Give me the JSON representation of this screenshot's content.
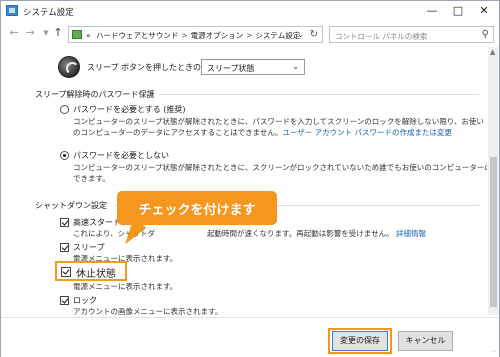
{
  "window": {
    "title": "システム設定"
  },
  "address": {
    "crumbs": [
      "«",
      "ハードウェアとサウンド",
      "電源オプション",
      "システム設定"
    ],
    "separators": [
      ">",
      ">"
    ],
    "search_placeholder": "コントロール パネルの検索"
  },
  "sleep_button": {
    "label": "スリープ ボタンを押したときの動作:",
    "value": "スリープ状態"
  },
  "wake_password": {
    "heading": "スリープ解除時のパスワード保護",
    "require": {
      "label": "パスワードを必要とする (推奨)",
      "desc_line1": "コンピューターのスリープ状態が解除されたときに、パスワードを入力してスクリーンのロックを解除しない限り、お使い",
      "desc_line2": "のコンピューターのデータにアクセスすることはできません。",
      "link_text": "ユーザー アカウント パスワードの作成または変更",
      "selected": false
    },
    "no_require": {
      "label": "パスワードを必要としない",
      "desc_line1": "コンピューターのスリープ状態が解除されたときに、スクリーンがロックされていないため誰でもお使いのコンピューターのデータにアクセス",
      "desc_line2": "できます。",
      "selected": true
    }
  },
  "shutdown": {
    "heading": "シャットダウン設定",
    "fast_startup": {
      "label": "高速スタートアップ",
      "desc": "これにより、シャットダウン後の PC の起動時間が速くなります。再起動は影響を受けません。",
      "desc_prefix": "これにより、シャットダ",
      "desc_suffix": "起動時間が速くなります。再起動は影響を受けません。",
      "link_text": "詳細情報",
      "checked": true
    },
    "sleep": {
      "label": "スリープ",
      "desc": "電源メニューに表示されます。",
      "checked": true
    },
    "hibernate": {
      "label": "休止状態",
      "desc": "電源メニューに表示されます。",
      "checked": true
    },
    "lock": {
      "label": "ロック",
      "desc": "アカウントの画像メニューに表示されます。",
      "checked": true
    }
  },
  "callout": {
    "text": "チェックを付けます"
  },
  "footer": {
    "save_label": "変更の保存",
    "cancel_label": "キャンセル"
  },
  "colors": {
    "highlight": "#f29a1f",
    "callout": "#f5961e",
    "link": "#1a5fb4"
  }
}
